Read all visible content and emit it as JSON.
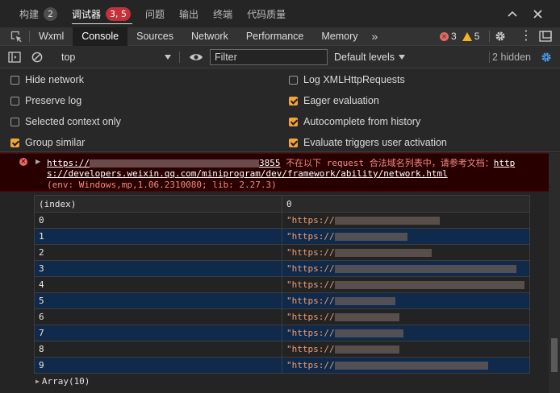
{
  "panel_tabs": [
    {
      "label": "构建",
      "badge": "2"
    },
    {
      "label": "调试器",
      "badge": "3, 5"
    },
    {
      "label": "问题"
    },
    {
      "label": "输出"
    },
    {
      "label": "终端"
    },
    {
      "label": "代码质量"
    }
  ],
  "devtools_tabs": [
    "Wxml",
    "Console",
    "Sources",
    "Network",
    "Performance",
    "Memory"
  ],
  "status": {
    "errors": "3",
    "warnings": "5"
  },
  "toolbar": {
    "context": "top",
    "filter_placeholder": "Filter",
    "levels": "Default levels",
    "hidden": "2 hidden"
  },
  "settings": {
    "left": [
      {
        "label": "Hide network",
        "checked": false
      },
      {
        "label": "Preserve log",
        "checked": false
      },
      {
        "label": "Selected context only",
        "checked": false
      },
      {
        "label": "Group similar",
        "checked": true
      }
    ],
    "right": [
      {
        "label": "Log XMLHttpRequests",
        "checked": false
      },
      {
        "label": "Eager evaluation",
        "checked": true
      },
      {
        "label": "Autocomplete from history",
        "checked": true
      },
      {
        "label": "Evaluate triggers user activation",
        "checked": true
      }
    ]
  },
  "error": {
    "url_start": "https://",
    "url_end": "3855",
    "message": " 不在以下 request 合法域名列表中，请参考文档：",
    "doc_link_a": "http",
    "doc_link_b": "s://developers.weixin.qq.com/miniprogram/dev/framework/ability/network.html",
    "env": "(env: Windows,mp,1.06.2310080; lib: 2.27.3)"
  },
  "table": {
    "headers": [
      "(index)",
      "0"
    ],
    "rows": [
      {
        "index": "0",
        "value": "\"https://"
      },
      {
        "index": "1",
        "value": "\"https://"
      },
      {
        "index": "2",
        "value": "\"https://"
      },
      {
        "index": "3",
        "value": "\"https://"
      },
      {
        "index": "4",
        "value": "\"https://"
      },
      {
        "index": "5",
        "value": "\"https://"
      },
      {
        "index": "6",
        "value": "\"https://"
      },
      {
        "index": "7",
        "value": "\"https://"
      },
      {
        "index": "8",
        "value": "\"https://"
      },
      {
        "index": "9",
        "value": "\"https://"
      }
    ]
  },
  "array_summary": "Array(10)",
  "colors": {
    "accent": "#f5a43a",
    "error_bg": "#290000",
    "row_highlight": "#0f2a4a"
  }
}
